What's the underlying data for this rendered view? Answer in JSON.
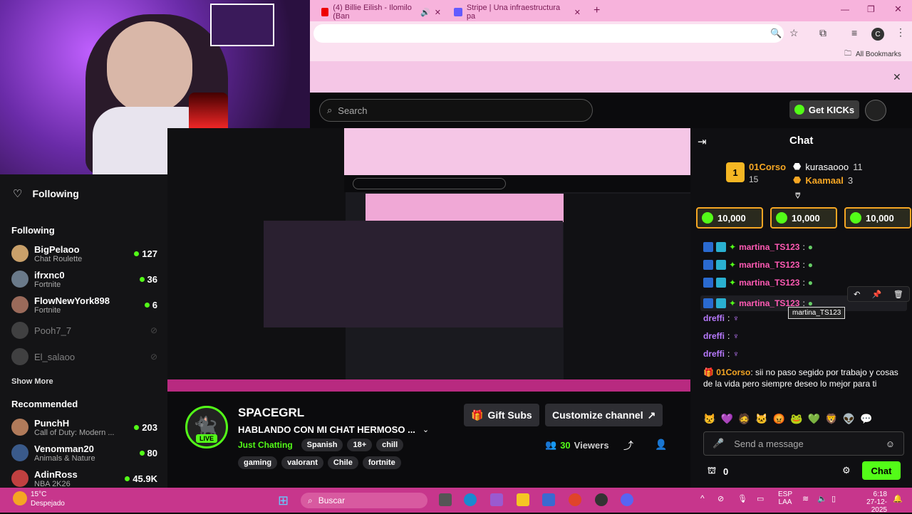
{
  "browser": {
    "tabs": [
      {
        "title": "(4) Billie Eilish - Ilomilo (Ban"
      },
      {
        "title": "Stripe | Una infraestructura pa"
      }
    ],
    "bookmarks_label": "All Bookmarks",
    "profile_initial": "C"
  },
  "header": {
    "search_placeholder": "Search",
    "get_kicks_label": "Get KICKs"
  },
  "sidebar": {
    "top_label": "Following",
    "following_title": "Following",
    "following": [
      {
        "name": "BigPelaoo",
        "category": "Chat Roulette",
        "viewers": "127",
        "live": true
      },
      {
        "name": "ifrxnc0",
        "category": "Fortnite",
        "viewers": "36",
        "live": true
      },
      {
        "name": "FlowNewYork898",
        "category": "Fortnite",
        "viewers": "6",
        "live": true
      },
      {
        "name": "Pooh7_7",
        "category": "",
        "viewers": "",
        "live": false
      },
      {
        "name": "El_salaoo",
        "category": "",
        "viewers": "",
        "live": false
      }
    ],
    "show_more": "Show More",
    "recommended_title": "Recommended",
    "recommended": [
      {
        "name": "PunchH",
        "category": "Call of Duty: Modern ...",
        "viewers": "203"
      },
      {
        "name": "Venomman20",
        "category": "Animals & Nature",
        "viewers": "80"
      },
      {
        "name": "AdinRoss",
        "category": "NBA 2K26",
        "viewers": "45.9K"
      }
    ]
  },
  "stream": {
    "channel_name": "SPACEGRL",
    "title": "HABLANDO CON MI CHAT HERMOSO ...",
    "category": "Just Chatting",
    "tags_top": [
      "Spanish",
      "18+",
      "chill"
    ],
    "tags_bottom": [
      "gaming",
      "valorant",
      "Chile",
      "fortnite"
    ],
    "live_badge": "LIVE",
    "gift_subs_label": "Gift Subs",
    "customize_label": "Customize channel",
    "viewers_count": "30",
    "viewers_label": "Viewers"
  },
  "chat": {
    "title": "Chat",
    "leaderboard": [
      {
        "rank": "1",
        "name": "01Corso",
        "count": "15"
      },
      {
        "name": "kurasaooo",
        "count": "11"
      },
      {
        "name": "Kaamaal",
        "count": "3"
      }
    ],
    "gifts": [
      "10,000",
      "10,000",
      "10,000"
    ],
    "messages": [
      {
        "user": "martina_TS123",
        "sep": ":"
      },
      {
        "user": "martina_TS123",
        "sep": ":"
      },
      {
        "user": "martina_TS123",
        "sep": ":"
      },
      {
        "user": "martina_TS123",
        "sep": ":"
      },
      {
        "user": "dreffi",
        "sep": ":"
      },
      {
        "user": "dreffi",
        "sep": ":"
      },
      {
        "user": "dreffi",
        "sep": ":"
      }
    ],
    "tooltip": "martina_TS123",
    "long_message": {
      "user": "01Corso",
      "text": "sii no paso segido por trabajo y cosas de la vida pero siempre deseo lo mejor para ti"
    },
    "input_placeholder": "Send a message",
    "points": "0",
    "send_label": "Chat"
  },
  "taskbar": {
    "weather_temp": "15°C",
    "weather_desc": "Despejado",
    "search_label": "Buscar",
    "lang1": "ESP",
    "lang2": "LAA",
    "time": "6:18",
    "date": "27-12-2025"
  },
  "colors": {
    "kick_green": "#53fc18",
    "username_pink": "#ff5ab4",
    "taskbar": "#c7368c"
  }
}
